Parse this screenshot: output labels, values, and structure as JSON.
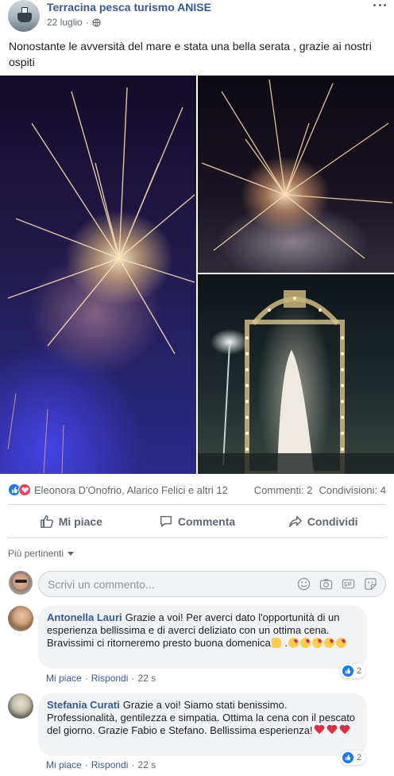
{
  "post": {
    "page_name": "Terracina pesca turismo ANISE",
    "date": "22 luglio",
    "date_separator": "·",
    "privacy_icon": "globe-icon",
    "text": "Nonostante le avversità del mare e stata una bella serata , grazie ai nostri ospiti"
  },
  "reactions": {
    "names": "Eleonora D'Onofrio, Alarico Felici e altri 12",
    "comments": "Commenti: 2",
    "shares": "Condivisioni: 4",
    "icons": [
      "like-icon",
      "love-icon"
    ]
  },
  "actions": {
    "like": "Mi piace",
    "comment": "Commenta",
    "share": "Condividi"
  },
  "filter": {
    "label": "Più pertinenti"
  },
  "compose": {
    "placeholder": "Scrivi un commento...",
    "icons": [
      "emoji-icon",
      "camera-icon",
      "gif-icon",
      "sticker-icon"
    ]
  },
  "comments": [
    {
      "author": "Antonella Lauri",
      "text": "Grazie a voi! Per averci dato l'opportunità di un esperienza bellissima e di averci deliziato con un ottima cena. Bravissimi ci ritorneremo presto buona domenica",
      "like_label": "Mi piace",
      "reply_label": "Rispondi",
      "separator": "·",
      "time": "22 s",
      "likes": "2"
    },
    {
      "author": "Stefania Curati",
      "text": "Grazie a voi! Siamo stati benissimo. Professionalità, gentilezza e simpatia. Ottima la cena con il pescato del giorno. Grazie Fabio e Stefano. Bellissima esperienza!",
      "like_label": "Mi piace",
      "reply_label": "Rispondi",
      "separator": "·",
      "time": "22 s",
      "likes": "2"
    }
  ],
  "colors": {
    "link_blue": "#385898",
    "like_blue": "#1877f2",
    "love_red": "#f33e58",
    "muted": "#606770"
  }
}
